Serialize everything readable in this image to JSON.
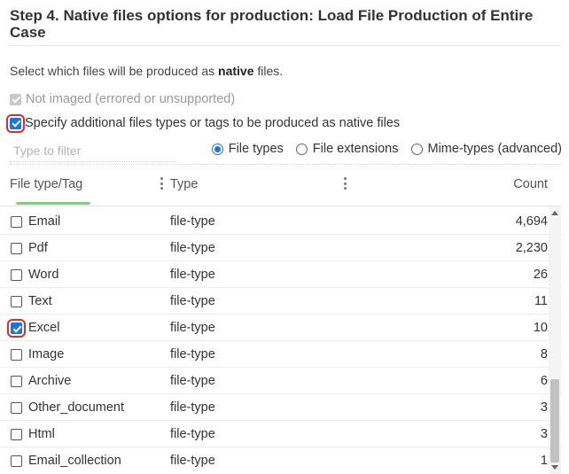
{
  "step_title": "Step 4. Native files options for production: Load File Production of Entire Case",
  "instruction": {
    "prefix": "Select which files will be produced as ",
    "bold": "native",
    "suffix": " files."
  },
  "options": {
    "not_imaged": {
      "label": "Not imaged (errored or unsupported)",
      "checked": true,
      "disabled": true
    },
    "specify_additional": {
      "label": "Specify additional files types or tags to be produced as native files",
      "checked": true
    }
  },
  "filter": {
    "placeholder": "Type to filter",
    "value": ""
  },
  "view_modes": [
    {
      "label": "File types",
      "selected": true
    },
    {
      "label": "File extensions",
      "selected": false
    },
    {
      "label": "Mime-types (advanced)",
      "selected": false
    }
  ],
  "grid": {
    "headers": {
      "name": "File type/Tag",
      "type": "Type",
      "count": "Count"
    },
    "rows": [
      {
        "name": "Email",
        "type": "file-type",
        "count": "4,694",
        "checked": false
      },
      {
        "name": "Pdf",
        "type": "file-type",
        "count": "2,230",
        "checked": false
      },
      {
        "name": "Word",
        "type": "file-type",
        "count": "26",
        "checked": false
      },
      {
        "name": "Text",
        "type": "file-type",
        "count": "11",
        "checked": false
      },
      {
        "name": "Excel",
        "type": "file-type",
        "count": "10",
        "checked": true
      },
      {
        "name": "Image",
        "type": "file-type",
        "count": "8",
        "checked": false
      },
      {
        "name": "Archive",
        "type": "file-type",
        "count": "6",
        "checked": false
      },
      {
        "name": "Other_document",
        "type": "file-type",
        "count": "3",
        "checked": false
      },
      {
        "name": "Html",
        "type": "file-type",
        "count": "3",
        "checked": false
      },
      {
        "name": "Email_collection",
        "type": "file-type",
        "count": "1",
        "checked": false
      }
    ]
  },
  "colors": {
    "accent": "#1a73e8",
    "highlight": "#d32f2f",
    "header_underline": "#7dcf7d"
  }
}
